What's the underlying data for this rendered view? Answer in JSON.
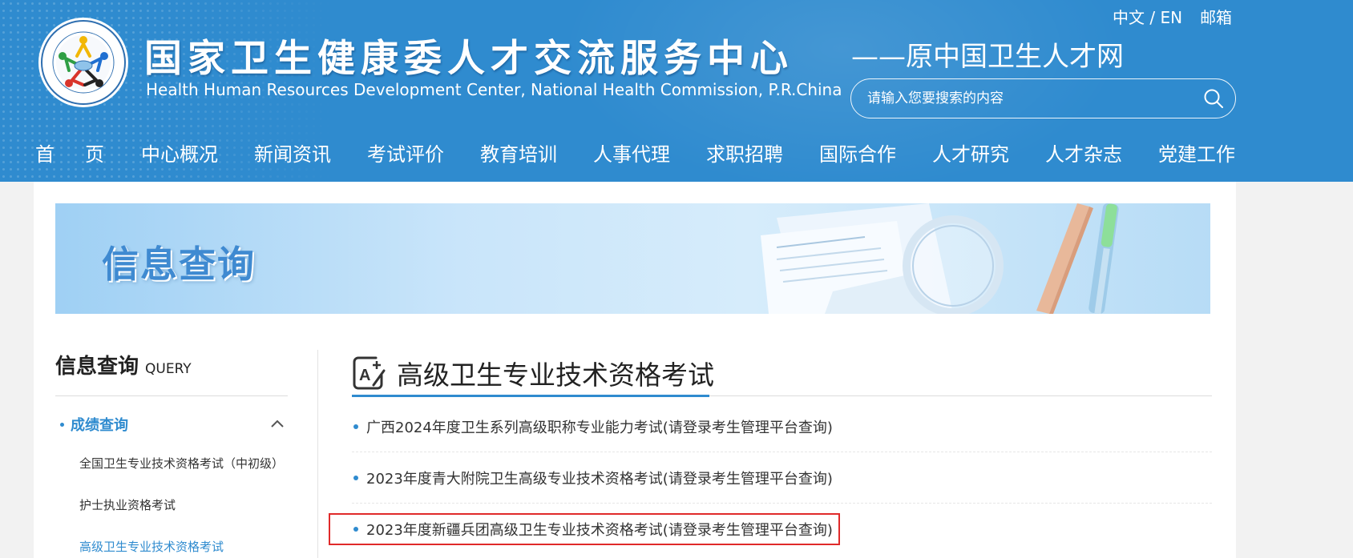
{
  "header": {
    "title": "国家卫生健康委人才交流服务中心",
    "subtitle_en": "Health Human Resources Development Center, National Health Commission, P.R.China",
    "slogan": "——原中国卫生人才网",
    "lang_switch": "中文 / EN",
    "mail_link": "邮箱",
    "search_placeholder": "请输入您要搜索的内容",
    "logo_icon": "organization-logo"
  },
  "nav": {
    "items": [
      "首页",
      "中心概况",
      "新闻资讯",
      "考试评价",
      "教育培训",
      "人事代理",
      "求职招聘",
      "国际合作",
      "人才研究",
      "人才杂志",
      "党建工作"
    ]
  },
  "banner": {
    "title": "信息查询"
  },
  "sidebar": {
    "title_cn": "信息查询",
    "title_en": "QUERY",
    "group_label": "成绩查询",
    "items": [
      {
        "label": "全国卫生专业技术资格考试（中初级）"
      },
      {
        "label": "护士执业资格考试"
      },
      {
        "label": "高级卫生专业技术资格考试"
      }
    ]
  },
  "main": {
    "title": "高级卫生专业技术资格考试",
    "items": [
      {
        "text": "广西2024年度卫生系列高级职称专业能力考试(请登录考生管理平台查询)"
      },
      {
        "text": "2023年度青大附院卫生高级专业技术资格考试(请登录考生管理平台查询)"
      },
      {
        "text": "2023年度新疆兵团高级卫生专业技术资格考试(请登录考生管理平台查询)"
      }
    ]
  },
  "colors": {
    "brand_blue": "#2f8bcf",
    "highlight_red": "#e02a2a"
  }
}
